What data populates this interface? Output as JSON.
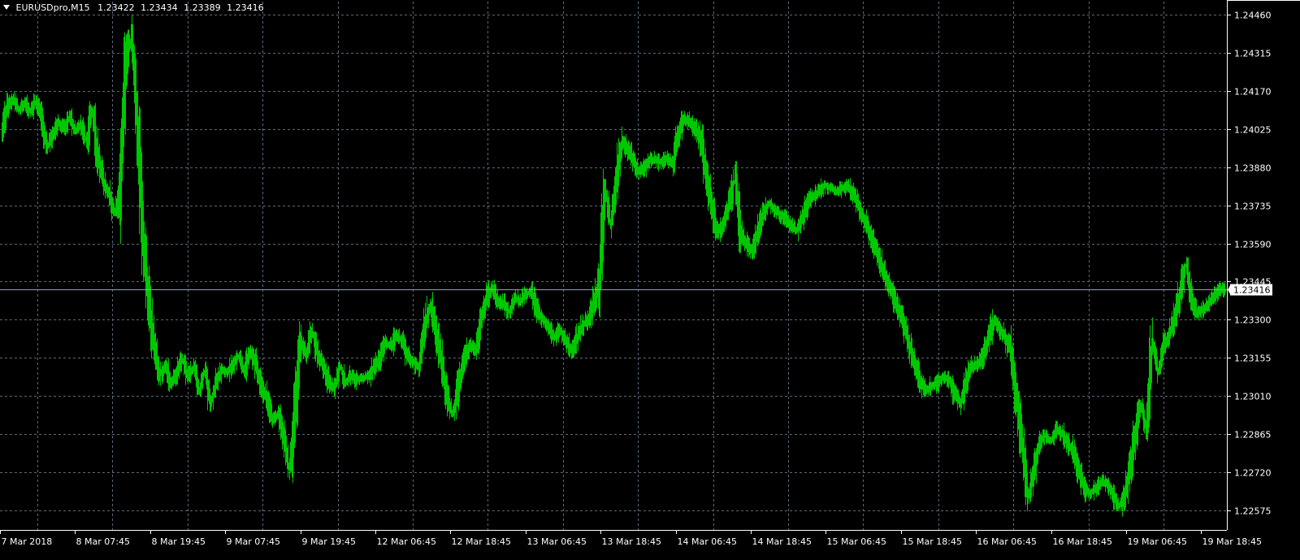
{
  "chart_data": {
    "type": "line",
    "symbol": "EURUSDpro,M15",
    "ohlc": {
      "open": "1.23422",
      "high": "1.23434",
      "low": "1.23389",
      "close": "1.23416"
    },
    "current_price_label": "1.23416",
    "current_price": 1.23416,
    "ylim": [
      1.225,
      1.2451
    ],
    "y_ticks": [
      "1.24460",
      "1.24315",
      "1.24170",
      "1.24025",
      "1.23880",
      "1.23735",
      "1.23590",
      "1.23445",
      "1.23300",
      "1.23155",
      "1.23010",
      "1.22865",
      "1.22720",
      "1.22575"
    ],
    "x_ticks": [
      "7 Mar 2018",
      "8 Mar 07:45",
      "8 Mar 19:45",
      "9 Mar 07:45",
      "9 Mar 19:45",
      "12 Mar 06:45",
      "12 Mar 18:45",
      "13 Mar 06:45",
      "13 Mar 18:45",
      "14 Mar 06:45",
      "14 Mar 18:45",
      "15 Mar 06:45",
      "15 Mar 18:45",
      "16 Mar 06:45",
      "16 Mar 18:45",
      "19 Mar 06:45",
      "19 Mar 18:45"
    ],
    "grid": true,
    "colors": {
      "background": "#000000",
      "bars": "#00c800",
      "grid": "#5a6a7a",
      "axis": "#ffffff",
      "price_line": "#8fa3b8"
    },
    "series": [
      {
        "values": [
          1.2402,
          1.2411,
          1.2414,
          1.241,
          1.2412,
          1.2409,
          1.2413,
          1.2408,
          1.2396,
          1.24,
          1.2405,
          1.2403,
          1.2407,
          1.2402,
          1.2404,
          1.2398,
          1.241,
          1.2393,
          1.2382,
          1.2378,
          1.2371,
          1.2379,
          1.2429,
          1.2437,
          1.2405,
          1.2362,
          1.2338,
          1.232,
          1.2309,
          1.2312,
          1.2306,
          1.231,
          1.2315,
          1.2309,
          1.2312,
          1.2303,
          1.231,
          1.2298,
          1.2306,
          1.2311,
          1.231,
          1.2313,
          1.2316,
          1.231,
          1.2318,
          1.2313,
          1.2305,
          1.23,
          1.2292,
          1.2294,
          1.2285,
          1.2272,
          1.2295,
          1.2322,
          1.2316,
          1.2326,
          1.2317,
          1.2313,
          1.2306,
          1.2304,
          1.2312,
          1.2306,
          1.2309,
          1.2307,
          1.2308,
          1.2308,
          1.2312,
          1.2315,
          1.2321,
          1.232,
          1.2324,
          1.2322,
          1.2316,
          1.2314,
          1.2312,
          1.2327,
          1.2336,
          1.2325,
          1.2313,
          1.23,
          1.2294,
          1.2305,
          1.2314,
          1.2321,
          1.2318,
          1.233,
          1.2338,
          1.2342,
          1.2337,
          1.2336,
          1.2333,
          1.2338,
          1.2337,
          1.234,
          1.234,
          1.2333,
          1.233,
          1.2327,
          1.2323,
          1.2326,
          1.2322,
          1.2318,
          1.2323,
          1.2328,
          1.233,
          1.2337,
          1.2345,
          1.238,
          1.2365,
          1.2385,
          1.2398,
          1.2395,
          1.239,
          1.2386,
          1.2388,
          1.2391,
          1.2391,
          1.239,
          1.2391,
          1.2389,
          1.2401,
          1.2406,
          1.2405,
          1.2402,
          1.2398,
          1.2383,
          1.2372,
          1.2363,
          1.2367,
          1.2374,
          1.2384,
          1.2362,
          1.2359,
          1.2356,
          1.2363,
          1.237,
          1.2374,
          1.2372,
          1.237,
          1.2368,
          1.2366,
          1.2364,
          1.2369,
          1.2375,
          1.2377,
          1.2379,
          1.2381,
          1.238,
          1.2379,
          1.238,
          1.2381,
          1.2378,
          1.2373,
          1.2368,
          1.2362,
          1.2357,
          1.235,
          1.2345,
          1.234,
          1.2334,
          1.2328,
          1.232,
          1.2313,
          1.2306,
          1.2303,
          1.2305,
          1.2306,
          1.2308,
          1.2307,
          1.2302,
          1.2298,
          1.2307,
          1.2312,
          1.2313,
          1.2316,
          1.2323,
          1.233,
          1.2327,
          1.2323,
          1.2318,
          1.23,
          1.2281,
          1.2262,
          1.2272,
          1.2283,
          1.2286,
          1.2284,
          1.2288,
          1.2287,
          1.2283,
          1.228,
          1.2272,
          1.2266,
          1.2264,
          1.2266,
          1.2268,
          1.2268,
          1.2264,
          1.2259,
          1.2262,
          1.2273,
          1.2286,
          1.2297,
          1.2288,
          1.2322,
          1.231,
          1.2319,
          1.2324,
          1.2331,
          1.2341,
          1.2351,
          1.2338,
          1.2332,
          1.2334,
          1.2336,
          1.2339,
          1.2342,
          1.2341
        ]
      }
    ]
  }
}
